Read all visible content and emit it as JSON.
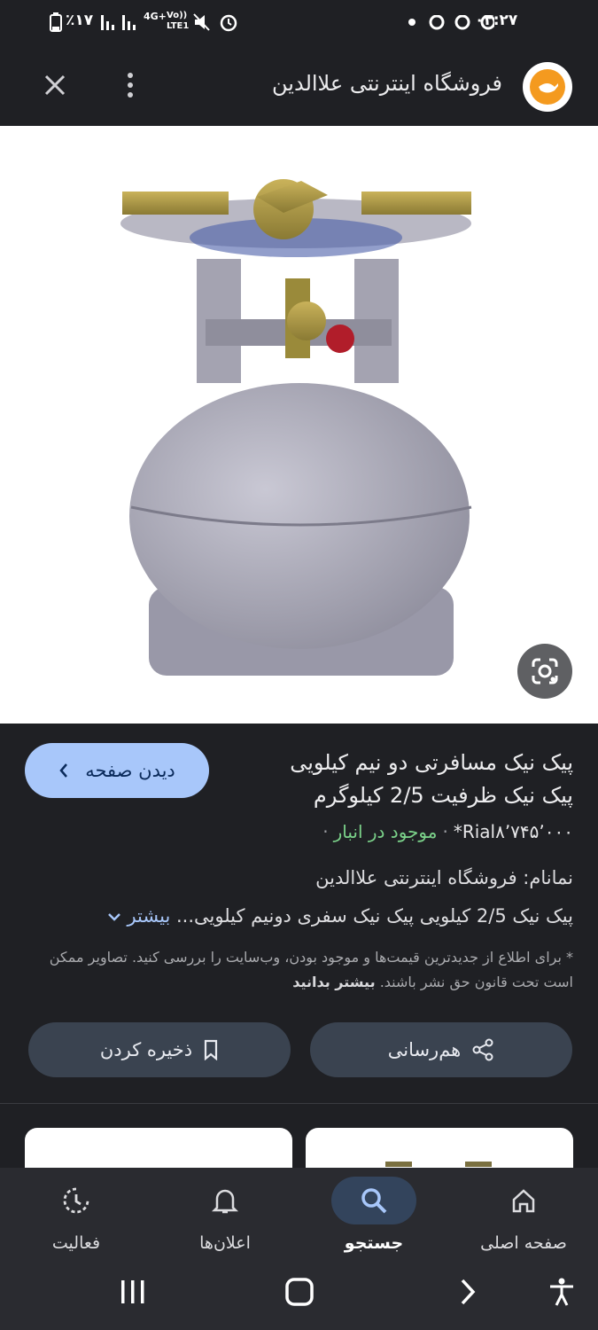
{
  "status_bar": {
    "time": "۰۲:۲۷",
    "battery": "٪۱۷",
    "network": "4G+",
    "volte": "Vo)) LTE1"
  },
  "header": {
    "title": "فروشگاه اینترنتی علاالدین",
    "close_icon": "close-icon",
    "menu_icon": "more-vert-icon",
    "logo_icon": "aladdin-lamp-logo"
  },
  "product": {
    "title_line1": "پیک نیک مسافرتی دو نیم کیلویی",
    "title_line2": "پیک نیک ظرفیت 2/5 کیلوگرم",
    "price": "Rial۸٬۷۴۵٬۰۰۰*",
    "stock": "موجود در انبار",
    "seller": "نمانام: فروشگاه اینترنتی علاالدین",
    "description": "پیک نیک 2/5 کیلویی پیک نیک سفری دونیم کیلویی...",
    "more_label": "بیشتر",
    "disclaimer": "* برای اطلاع از جدیدترین قیمت‌ها و موجود بودن، وب‌سایت را بررسی کنید. تصاویر ممکن است تحت قانون حق نشر باشند.",
    "learn_more": "بیشتر بدانید"
  },
  "actions": {
    "view_page": "دیدن صفحه",
    "share": "هم‌رسانی",
    "save": "ذخیره کردن"
  },
  "bottom_nav": [
    {
      "label": "صفحه اصلی",
      "icon": "home-icon"
    },
    {
      "label": "جستجو",
      "icon": "search-icon",
      "active": true
    },
    {
      "label": "اعلان‌ها",
      "icon": "bell-icon"
    },
    {
      "label": "فعالیت",
      "icon": "activity-icon"
    }
  ],
  "colors": {
    "background": "#1f2024",
    "accent_blue": "#a8c7fa",
    "stock_green": "#7bd28a",
    "logo_orange": "#f49a1f"
  }
}
